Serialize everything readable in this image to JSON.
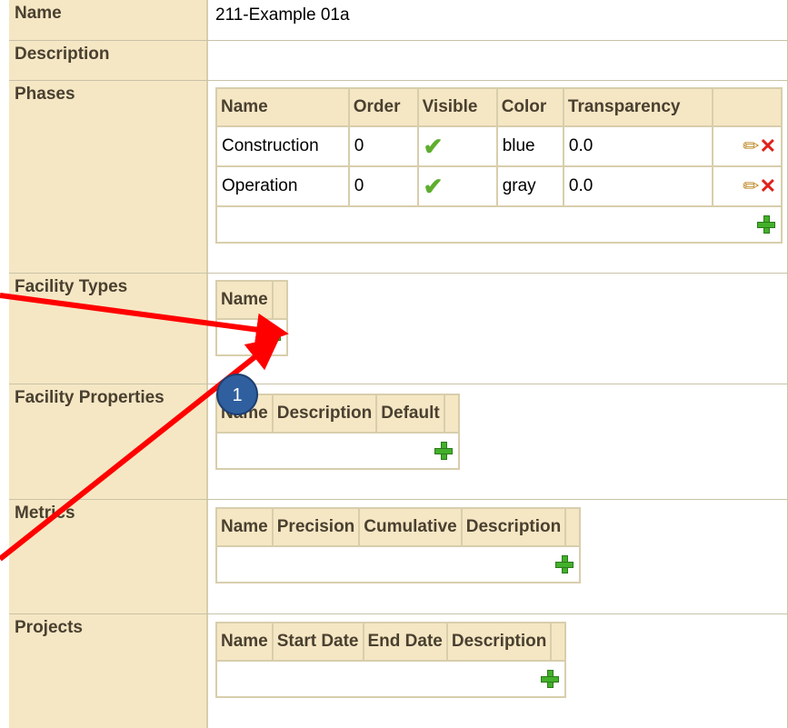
{
  "properties": {
    "name": {
      "label": "Name",
      "value": "211-Example 01a"
    },
    "description": {
      "label": "Description",
      "value": ""
    },
    "phases": {
      "label": "Phases",
      "columns": [
        "Name",
        "Order",
        "Visible",
        "Color",
        "Transparency",
        ""
      ],
      "rows": [
        {
          "name": "Construction",
          "order": "0",
          "visible": true,
          "color": "blue",
          "transparency": "0.0"
        },
        {
          "name": "Operation",
          "order": "0",
          "visible": true,
          "color": "gray",
          "transparency": "0.0"
        }
      ]
    },
    "facility_types": {
      "label": "Facility Types",
      "columns": [
        "Name"
      ]
    },
    "facility_properties": {
      "label": "Facility Properties",
      "columns": [
        "Name",
        "Description",
        "Default"
      ]
    },
    "metrics": {
      "label": "Metrics",
      "columns": [
        "Name",
        "Precision",
        "Cumulative",
        "Description"
      ]
    },
    "projects": {
      "label": "Projects",
      "columns": [
        "Name",
        "Start Date",
        "End Date",
        "Description"
      ]
    }
  },
  "icons": {
    "add": "plus-icon",
    "edit": "pencil-icon",
    "delete": "x-icon",
    "visible": "checkmark-icon"
  },
  "annotation": {
    "badge_label": "1",
    "arrow_color": "#ff0000",
    "badge_color": "#2f5f9e"
  }
}
